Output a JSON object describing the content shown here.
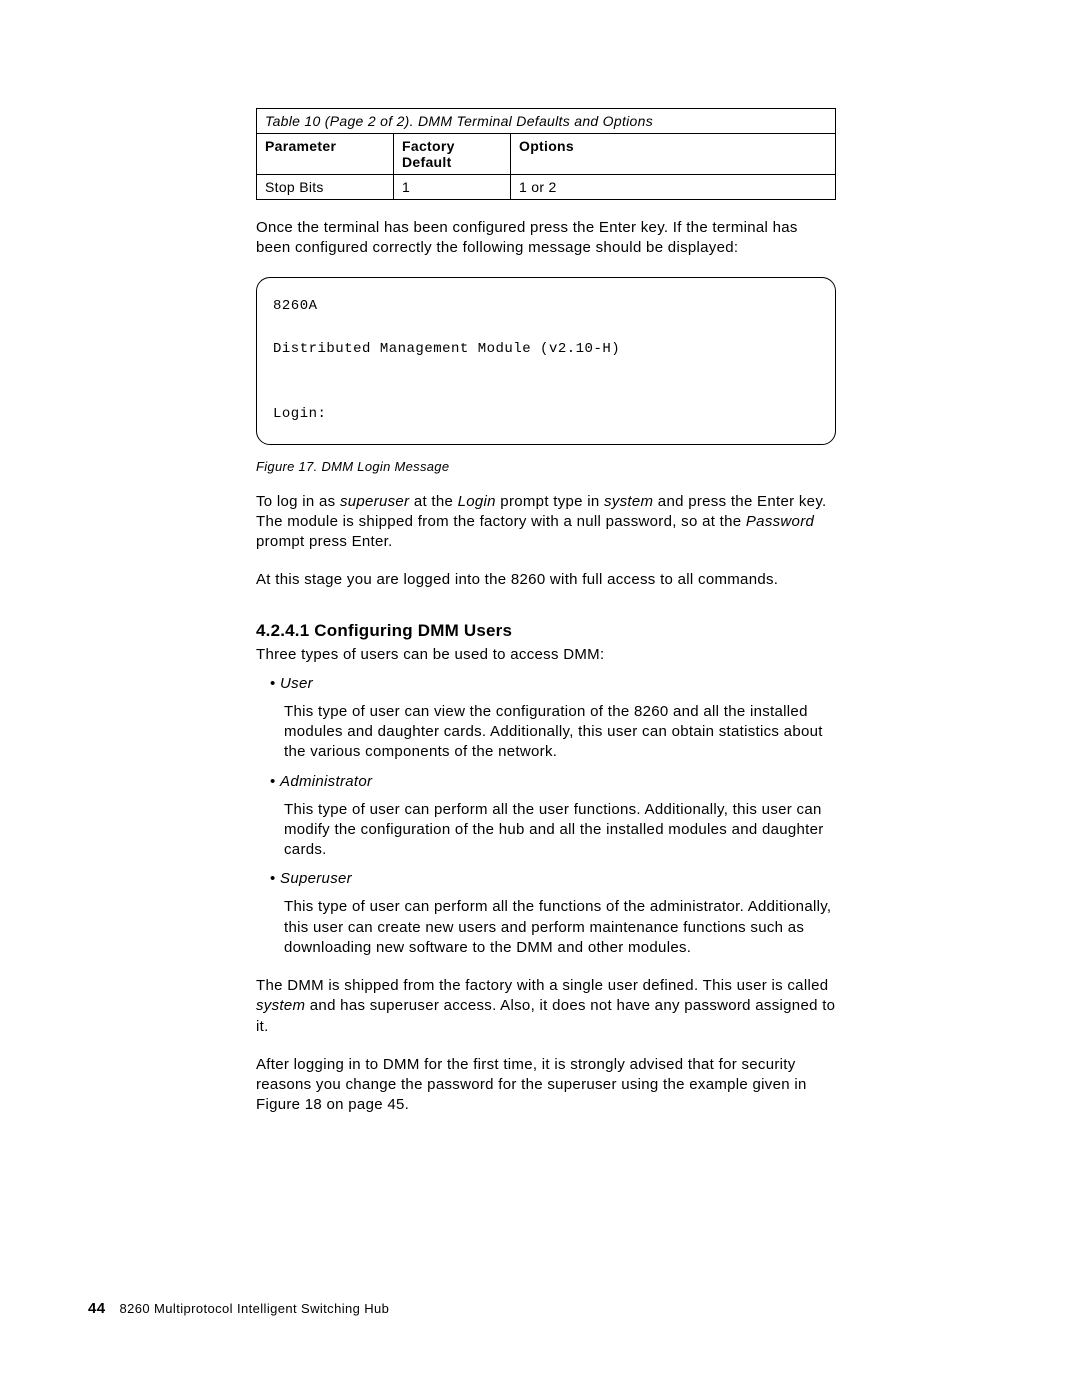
{
  "table": {
    "caption": "Table 10 (Page 2 of 2). DMM Terminal Defaults and Options",
    "headers": {
      "c1": "Parameter",
      "c2": "Factory Default",
      "c3": "Options"
    },
    "row": {
      "c1": "Stop Bits",
      "c2": "1",
      "c3": "1 or 2"
    }
  },
  "p1": "Once the terminal has been configured press the Enter key.  If the terminal has been configured correctly the following message should be displayed:",
  "code": "8260A\n\nDistributed Management Module (v2.10-H)\n\n\nLogin:",
  "fig_caption": "Figure 17. DMM Login Message",
  "p2_parts": {
    "a": "To log in as ",
    "b": "superuser",
    "c": " at the ",
    "d": "Login",
    "e": " prompt type in ",
    "f": "system",
    "g": " and press the Enter key.  The module is shipped from the factory with a null password, so at the ",
    "h": "Password",
    "i": " prompt press Enter."
  },
  "p3": "At this stage you are logged into the 8260 with full access to all commands.",
  "heading": "4.2.4.1  Configuring DMM Users",
  "p4": "Three types of users can be used to access DMM:",
  "items": [
    {
      "label": "User",
      "desc": "This type of user can view the configuration of the 8260 and all the installed modules and daughter cards.  Additionally, this user can obtain statistics about the various components of the network."
    },
    {
      "label": "Administrator",
      "desc": "This type of user can perform all the user functions.  Additionally, this user can modify the configuration of the hub and all the installed modules and daughter cards."
    },
    {
      "label": "Superuser",
      "desc": "This type of user can perform all the functions of the administrator.  Additionally, this user can create new users and perform maintenance functions such as downloading new software to the DMM and other modules."
    }
  ],
  "p5_parts": {
    "a": "The DMM is shipped from the factory with a single user defined.  This user is called ",
    "b": "system",
    "c": " and has superuser access.  Also, it does not have any password assigned to it."
  },
  "p6": "After logging in to DMM for the first time, it is strongly advised that for security reasons you change the password for the superuser using the example given in Figure 18 on page 45.",
  "footer": {
    "page": "44",
    "title": "8260 Multiprotocol Intelligent Switching Hub"
  }
}
